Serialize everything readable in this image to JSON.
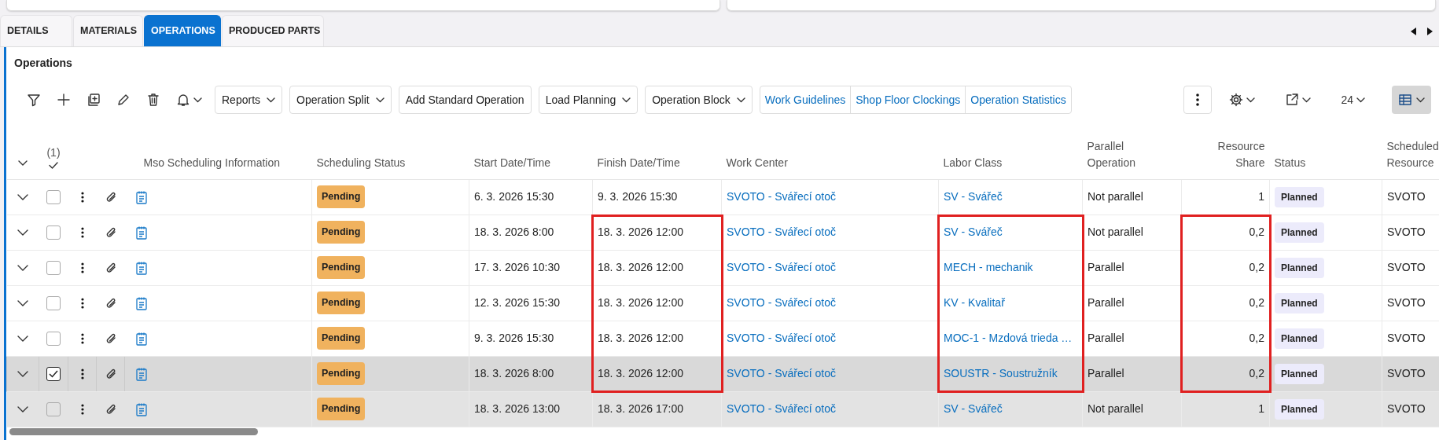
{
  "tabs": [
    {
      "label": "DETAILS",
      "selected": false
    },
    {
      "label": "MATERIALS",
      "selected": false
    },
    {
      "label": "OPERATIONS",
      "selected": true
    },
    {
      "label": "PRODUCED PARTS",
      "selected": false
    }
  ],
  "panel": {
    "title": "Operations"
  },
  "toolbar": {
    "buttons": [
      {
        "label": "Reports",
        "kind": "dropdown"
      },
      {
        "label": "Operation Split",
        "kind": "dropdown"
      },
      {
        "label": "Add Standard Operation",
        "kind": "plain"
      },
      {
        "label": "Load Planning",
        "kind": "dropdown"
      },
      {
        "label": "Operation Block",
        "kind": "dropdown"
      }
    ],
    "links": [
      "Work Guidelines",
      "Shop Floor Clockings",
      "Operation Statistics"
    ],
    "page_size": "24"
  },
  "table": {
    "selected_count": "(1)",
    "columns": [
      {
        "label": "Mso Scheduling Information",
        "kind": "info"
      },
      {
        "label": "Scheduling Status",
        "kind": "pending_badge"
      },
      {
        "label": "Start Date/Time",
        "kind": "text"
      },
      {
        "label": "Finish Date/Time",
        "kind": "text"
      },
      {
        "label": "Work Center",
        "kind": "link"
      },
      {
        "label": "Labor Class",
        "kind": "link"
      },
      {
        "label": "Parallel Operation",
        "kind": "text"
      },
      {
        "label": "Resource Share",
        "kind": "number"
      },
      {
        "label": "Status",
        "kind": "state_badge"
      },
      {
        "label": "Scheduled Resource",
        "kind": "text"
      }
    ],
    "rows": [
      {
        "selected": false,
        "hovered": false,
        "cells": [
          "",
          "Pending",
          "6. 3. 2026 15:30",
          "9. 3. 2026 15:30",
          "SVOTO - Svářecí otoč",
          "SV - Svářeč",
          "Not parallel",
          "1",
          "Planned",
          "SVOTO"
        ],
        "marked": [
          false,
          false,
          false,
          false,
          false,
          false,
          false,
          false,
          false,
          false
        ]
      },
      {
        "selected": false,
        "hovered": false,
        "cells": [
          "",
          "Pending",
          "18. 3. 2026 8:00",
          "18. 3. 2026 12:00",
          "SVOTO - Svářecí otoč",
          "SV - Svářeč",
          "Not parallel",
          "0,2",
          "Planned",
          "SVOTO"
        ],
        "marked": [
          false,
          false,
          false,
          true,
          false,
          true,
          false,
          true,
          false,
          false
        ]
      },
      {
        "selected": false,
        "hovered": false,
        "cells": [
          "",
          "Pending",
          "17. 3. 2026 10:30",
          "18. 3. 2026 12:00",
          "SVOTO - Svářecí otoč",
          "MECH - mechanik",
          "Parallel",
          "0,2",
          "Planned",
          "SVOTO"
        ],
        "marked": [
          false,
          false,
          false,
          true,
          false,
          true,
          false,
          true,
          false,
          false
        ]
      },
      {
        "selected": false,
        "hovered": false,
        "cells": [
          "",
          "Pending",
          "12. 3. 2026 15:30",
          "18. 3. 2026 12:00",
          "SVOTO - Svářecí otoč",
          "KV - Kvalitař",
          "Parallel",
          "0,2",
          "Planned",
          "SVOTO"
        ],
        "marked": [
          false,
          false,
          false,
          true,
          false,
          true,
          false,
          true,
          false,
          false
        ]
      },
      {
        "selected": false,
        "hovered": false,
        "cells": [
          "",
          "Pending",
          "9. 3. 2026 15:30",
          "18. 3. 2026 12:00",
          "SVOTO - Svářecí otoč",
          "MOC-1 - Mzdová trieda …",
          "Parallel",
          "0,2",
          "Planned",
          "SVOTO"
        ],
        "marked": [
          false,
          false,
          false,
          true,
          false,
          true,
          false,
          true,
          false,
          false
        ]
      },
      {
        "selected": true,
        "hovered": false,
        "cells": [
          "",
          "Pending",
          "18. 3. 2026 8:00",
          "18. 3. 2026 12:00",
          "SVOTO - Svářecí otoč",
          "SOUSTR - Soustružník",
          "Parallel",
          "0,2",
          "Planned",
          "SVOTO"
        ],
        "marked": [
          false,
          false,
          false,
          true,
          false,
          true,
          false,
          true,
          false,
          false
        ]
      },
      {
        "selected": false,
        "hovered": true,
        "cells": [
          "",
          "Pending",
          "18. 3. 2026 13:00",
          "18. 3. 2026 17:00",
          "SVOTO - Svářecí otoč",
          "SV - Svářeč",
          "Not parallel",
          "1",
          "Planned",
          "SVOTO"
        ],
        "marked": [
          false,
          false,
          false,
          false,
          false,
          false,
          false,
          false,
          false,
          false
        ]
      }
    ]
  }
}
